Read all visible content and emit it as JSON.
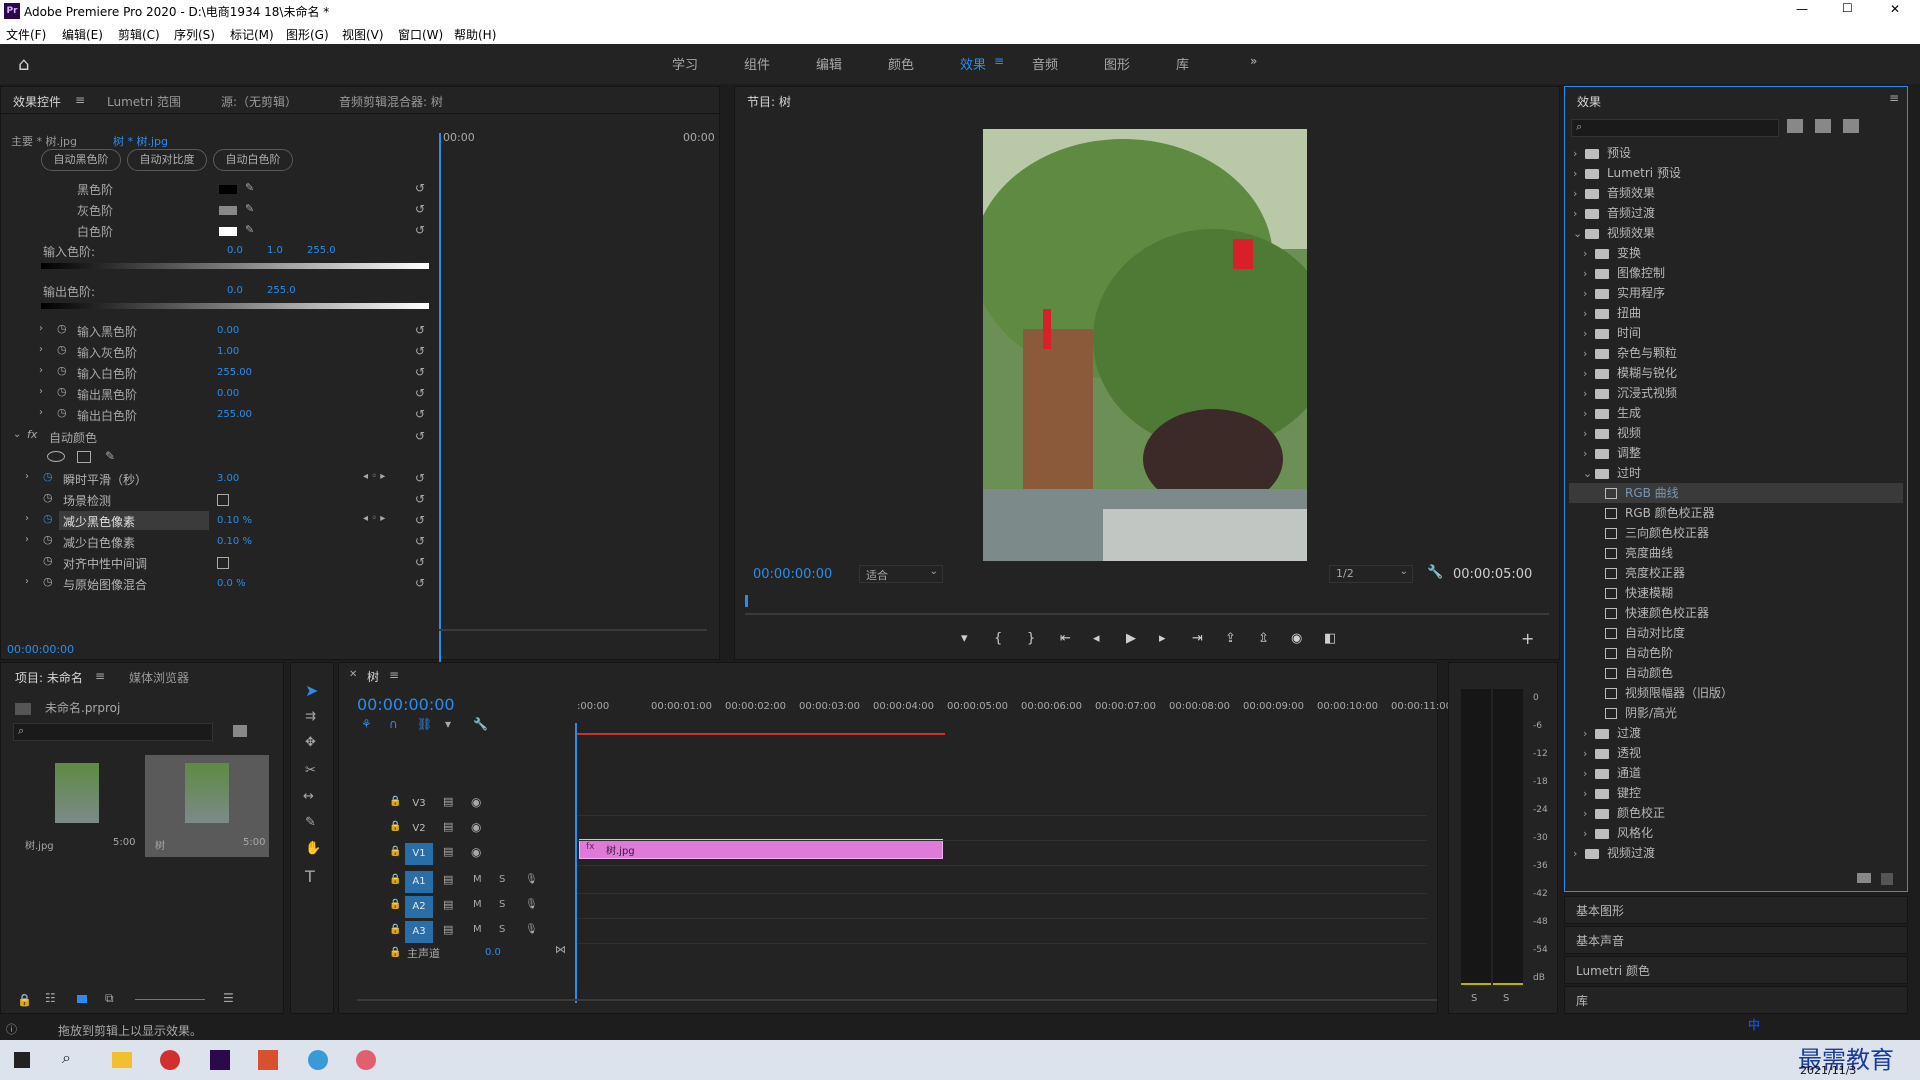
{
  "app": {
    "title": "Adobe Premiere Pro 2020 - D:\\电商1934 18\\未命名 *",
    "icon_label": "Pr"
  },
  "window_controls": {
    "minimize": "—",
    "maximize": "☐",
    "close": "✕"
  },
  "menu": [
    "文件(F)",
    "编辑(E)",
    "剪辑(C)",
    "序列(S)",
    "标记(M)",
    "图形(G)",
    "视图(V)",
    "窗口(W)",
    "帮助(H)"
  ],
  "workspaces": [
    "学习",
    "组件",
    "编辑",
    "颜色",
    "效果",
    "音频",
    "图形",
    "库"
  ],
  "workspace_active": "效果",
  "effect_controls": {
    "tabs": [
      "效果控件",
      "Lumetri 范围",
      "源:（无剪辑）",
      "音频剪辑混合器: 树"
    ],
    "master": "主要 * 树.jpg",
    "clip": "树 * 树.jpg",
    "times": [
      "00:00",
      "00:00"
    ],
    "buttons": [
      "自动黑色阶",
      "自动对比度",
      "自动白色阶"
    ],
    "levels": [
      {
        "label": "黑色阶"
      },
      {
        "label": "灰色阶"
      },
      {
        "label": "白色阶"
      }
    ],
    "input_label": "输入色阶:",
    "input_vals": [
      "0.0",
      "1.0",
      "255.0"
    ],
    "output_label": "输出色阶:",
    "output_vals": [
      "0.0",
      "255.0"
    ],
    "params": [
      {
        "label": "输入黑色阶",
        "value": "0.00"
      },
      {
        "label": "输入灰色阶",
        "value": "1.00"
      },
      {
        "label": "输入白色阶",
        "value": "255.00"
      },
      {
        "label": "输出黑色阶",
        "value": "0.00"
      },
      {
        "label": "输出白色阶",
        "value": "255.00"
      }
    ],
    "auto_color": "自动颜色",
    "ac_params": [
      {
        "label": "瞬时平滑（秒）",
        "value": "3.00",
        "kf": true
      },
      {
        "label": "场景检测",
        "checkbox": true
      },
      {
        "label": "减少黑色像素",
        "value": "0.10 %",
        "kf": true,
        "selected": true
      },
      {
        "label": "减少白色像素",
        "value": "0.10 %"
      },
      {
        "label": "对齐中性中间调",
        "checkbox": true
      },
      {
        "label": "与原始图像混合",
        "value": "0.0 %"
      }
    ],
    "timecode": "00:00:00:00"
  },
  "program": {
    "title": "节目: 树",
    "timecode": "00:00:00:00",
    "fit": "适合",
    "res": "1/2",
    "duration": "00:00:05:00"
  },
  "project": {
    "tabs": [
      "项目: 未命名",
      "媒体浏览器"
    ],
    "file": "未命名.prproj",
    "items": [
      {
        "name": "树.jpg",
        "dur": "5:00"
      },
      {
        "name": "树",
        "dur": "5:00"
      }
    ]
  },
  "timeline": {
    "name": "树",
    "timecode": "00:00:00:00",
    "ruler": [
      ":00:00",
      "00:00:01:00",
      "00:00:02:00",
      "00:00:03:00",
      "00:00:04:00",
      "00:00:05:00",
      "00:00:06:00",
      "00:00:07:00",
      "00:00:08:00",
      "00:00:09:00",
      "00:00:10:00",
      "00:00:11:00"
    ],
    "video_tracks": [
      "V3",
      "V2",
      "V1"
    ],
    "audio_tracks": [
      "A1",
      "A2",
      "A3"
    ],
    "master": "主声道",
    "master_val": "0.0",
    "clip": "树.jpg"
  },
  "meter": {
    "scale": [
      "0",
      "-6",
      "-12",
      "-18",
      "-24",
      "-30",
      "-36",
      "-42",
      "-48",
      "-54",
      "dB"
    ],
    "solo": [
      "S",
      "S"
    ]
  },
  "effects": {
    "title": "效果",
    "tree": [
      {
        "label": "预设",
        "lvl": 0,
        "t": "folder"
      },
      {
        "label": "Lumetri 预设",
        "lvl": 0,
        "t": "folder"
      },
      {
        "label": "音频效果",
        "lvl": 0,
        "t": "folder"
      },
      {
        "label": "音频过渡",
        "lvl": 0,
        "t": "folder"
      },
      {
        "label": "视频效果",
        "lvl": 0,
        "t": "folder",
        "open": true
      },
      {
        "label": "变换",
        "lvl": 1,
        "t": "folder"
      },
      {
        "label": "图像控制",
        "lvl": 1,
        "t": "folder"
      },
      {
        "label": "实用程序",
        "lvl": 1,
        "t": "folder"
      },
      {
        "label": "扭曲",
        "lvl": 1,
        "t": "folder"
      },
      {
        "label": "时间",
        "lvl": 1,
        "t": "folder"
      },
      {
        "label": "杂色与颗粒",
        "lvl": 1,
        "t": "folder"
      },
      {
        "label": "模糊与锐化",
        "lvl": 1,
        "t": "folder"
      },
      {
        "label": "沉浸式视频",
        "lvl": 1,
        "t": "folder"
      },
      {
        "label": "生成",
        "lvl": 1,
        "t": "folder"
      },
      {
        "label": "视频",
        "lvl": 1,
        "t": "folder"
      },
      {
        "label": "调整",
        "lvl": 1,
        "t": "folder"
      },
      {
        "label": "过时",
        "lvl": 1,
        "t": "folder",
        "open": true
      },
      {
        "label": "RGB 曲线",
        "lvl": 2,
        "t": "fx",
        "selected": true
      },
      {
        "label": "RGB 颜色校正器",
        "lvl": 2,
        "t": "fx"
      },
      {
        "label": "三向颜色校正器",
        "lvl": 2,
        "t": "fx"
      },
      {
        "label": "亮度曲线",
        "lvl": 2,
        "t": "fx"
      },
      {
        "label": "亮度校正器",
        "lvl": 2,
        "t": "fx"
      },
      {
        "label": "快速模糊",
        "lvl": 2,
        "t": "fx"
      },
      {
        "label": "快速颜色校正器",
        "lvl": 2,
        "t": "fx"
      },
      {
        "label": "自动对比度",
        "lvl": 2,
        "t": "fx"
      },
      {
        "label": "自动色阶",
        "lvl": 2,
        "t": "fx"
      },
      {
        "label": "自动颜色",
        "lvl": 2,
        "t": "fx"
      },
      {
        "label": "视频限幅器（旧版）",
        "lvl": 2,
        "t": "fx"
      },
      {
        "label": "阴影/高光",
        "lvl": 2,
        "t": "fx"
      },
      {
        "label": "过渡",
        "lvl": 1,
        "t": "folder"
      },
      {
        "label": "透视",
        "lvl": 1,
        "t": "folder"
      },
      {
        "label": "通道",
        "lvl": 1,
        "t": "folder"
      },
      {
        "label": "键控",
        "lvl": 1,
        "t": "folder"
      },
      {
        "label": "颜色校正",
        "lvl": 1,
        "t": "folder"
      },
      {
        "label": "风格化",
        "lvl": 1,
        "t": "folder"
      },
      {
        "label": "视频过渡",
        "lvl": 0,
        "t": "folder"
      }
    ],
    "sub_panels": [
      "基本图形",
      "基本声音",
      "Lumetri 颜色",
      "库"
    ]
  },
  "status": "拖放到剪辑上以显示效果。",
  "taskbar": {
    "date": "2021/11/3",
    "ime": "中",
    "watermark": "最需教育"
  },
  "colors": {
    "accent": "#2d8ceb",
    "clip": "#e07ad8",
    "playhead": "#2d8ceb",
    "selected_track": "#2a6ea8"
  }
}
